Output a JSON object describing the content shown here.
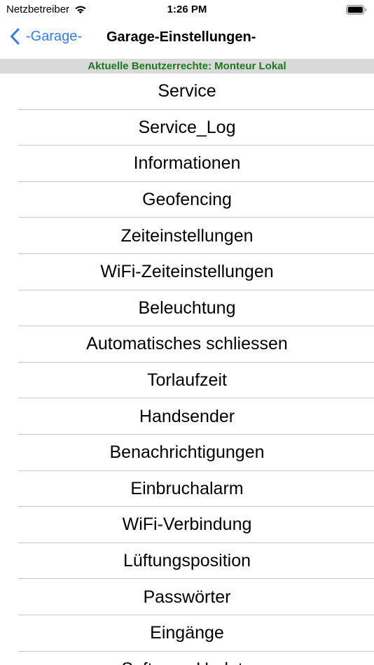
{
  "status_bar": {
    "carrier": "Netzbetreiber",
    "time": "1:26 PM",
    "icons": [
      "wifi-icon",
      "battery-icon"
    ]
  },
  "nav": {
    "back_label": "-Garage-",
    "title": "Garage-Einstellungen-",
    "back_icon": "chevron-left-icon",
    "accent_color": "#2f7cf6"
  },
  "banner": {
    "text": "Aktuelle Benutzerrechte: Monteur Lokal",
    "text_color": "#1a7a1a",
    "background": "#d9d9d9"
  },
  "menu": {
    "items": [
      "Service",
      "Service_Log",
      "Informationen",
      "Geofencing",
      "Zeiteinstellungen",
      "WiFi-Zeiteinstellungen",
      "Beleuchtung",
      "Automatisches schliessen",
      "Torlaufzeit",
      "Handsender",
      "Benachrichtigungen",
      "Einbruchalarm",
      "WiFi-Verbindung",
      "Lüftungsposition",
      "Passwörter",
      "Eingänge",
      "Software-Update"
    ]
  }
}
